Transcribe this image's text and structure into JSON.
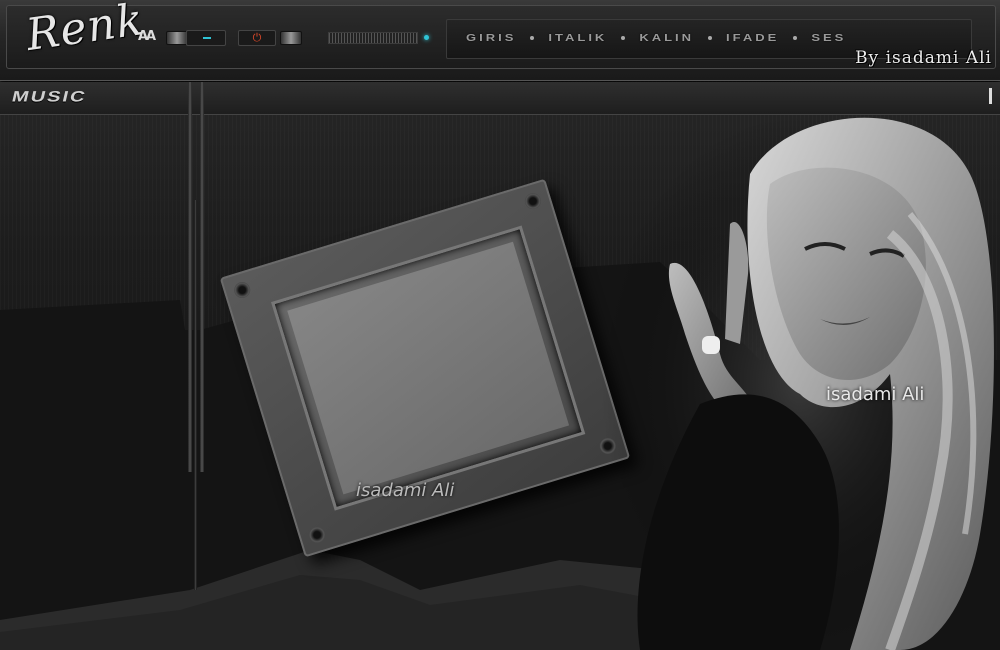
{
  "header": {
    "logo_text": "Renk",
    "font_glyph": "AA",
    "power_glyph": "⏻",
    "nav_items": [
      "GIRIS",
      "ITALIK",
      "KALIN",
      "IFADE",
      "SES"
    ],
    "byline": "By isadami Ali"
  },
  "subbar": {
    "section_label": "MUSIC",
    "marker": "I"
  },
  "watermarks": {
    "frame": "isadami Ali",
    "portrait": "isadami Ali"
  },
  "colors": {
    "accent_teal": "#2fc4d6",
    "power_red": "#e24a2a"
  },
  "icons": [
    "font-size-icon",
    "power-icon",
    "indicator-led-icon"
  ]
}
